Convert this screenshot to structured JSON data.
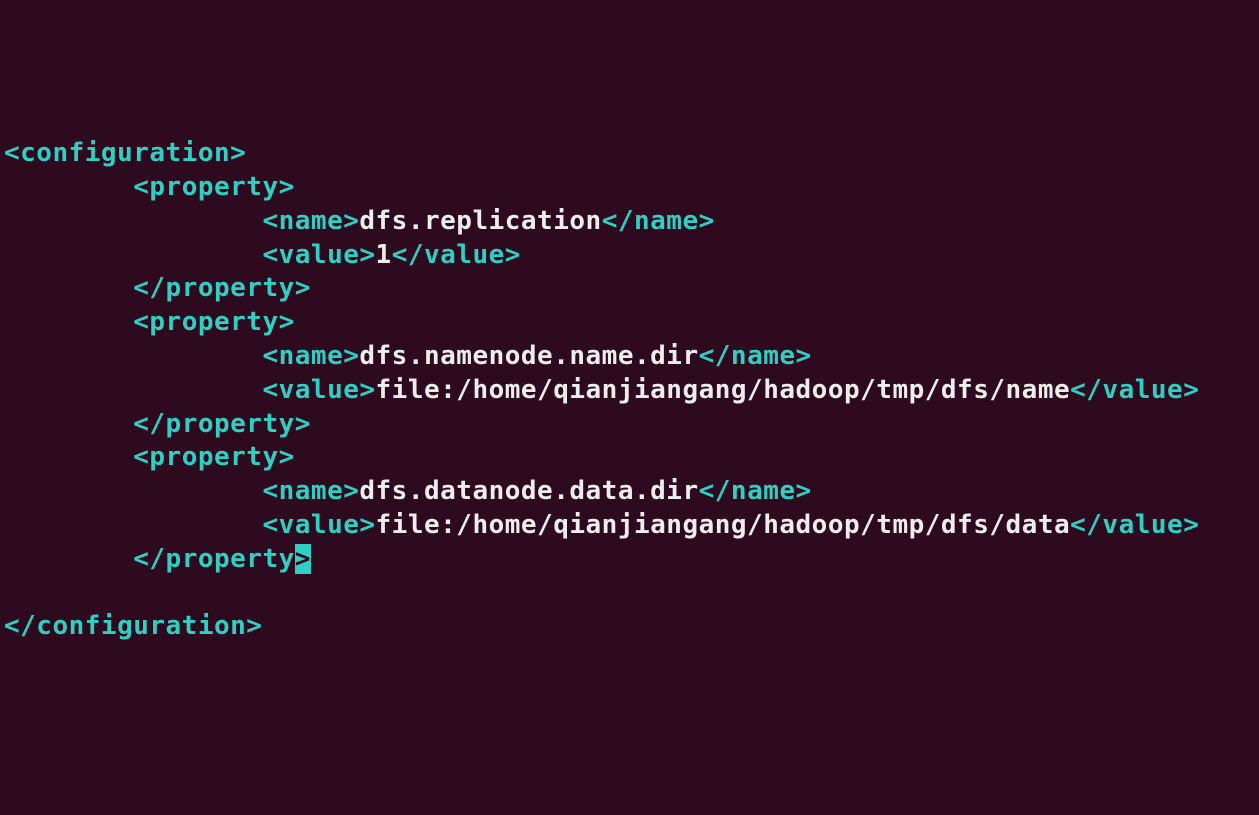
{
  "tags": {
    "configuration_open": "<configuration>",
    "configuration_close": "</configuration>",
    "property_open": "<property>",
    "property_close": "</property>",
    "property_close_no_last": "</property",
    "close_bracket": ">",
    "name_open": "<name>",
    "name_close": "</name>",
    "value_open": "<value>",
    "value_close": "</value>"
  },
  "properties": [
    {
      "name": "dfs.replication",
      "value": "1"
    },
    {
      "name": "dfs.namenode.name.dir",
      "value": "file:/home/qianjiangang/hadoop/tmp/dfs/name"
    },
    {
      "name": "dfs.datanode.data.dir",
      "value": "file:/home/qianjiangang/hadoop/tmp/dfs/data"
    }
  ]
}
